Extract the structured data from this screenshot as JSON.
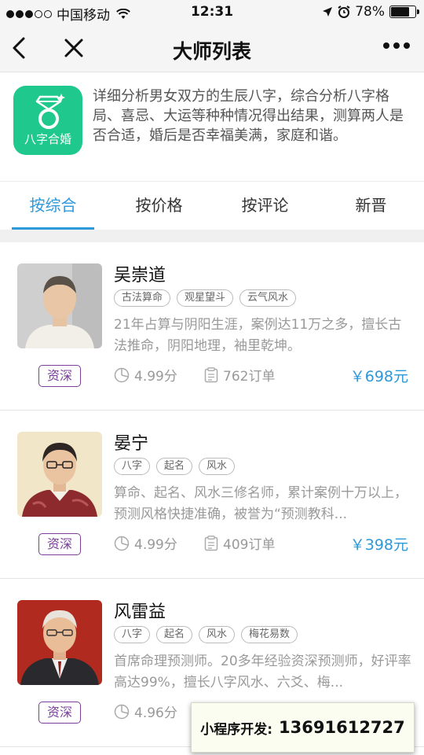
{
  "status_bar": {
    "carrier": "中国移动",
    "time": "12:31",
    "battery": "78%",
    "battery_level": 0.78,
    "signal_icon": "signal-dots-icon",
    "wifi_icon": "wifi-icon",
    "location_icon": "location-arrow-icon",
    "alarm_icon": "alarm-clock-icon"
  },
  "nav": {
    "title": "大师列表",
    "back_icon": "chevron-left-icon",
    "close_icon": "close-icon",
    "more_icon": "more-dots-icon"
  },
  "intro": {
    "icon_label": "八字合婚",
    "icon_color": "#1fc98d",
    "description": "详细分析男女双方的生辰八字，综合分析八字格局、喜忌、大运等种种情况得出结果，测算两人是否合适，婚后是否幸福美满，家庭和谐。"
  },
  "tabs": [
    {
      "label": "按综合",
      "active": true
    },
    {
      "label": "按价格",
      "active": false
    },
    {
      "label": "按评论",
      "active": false
    },
    {
      "label": "新晋",
      "active": false
    }
  ],
  "masters": [
    {
      "name": "吴崇道",
      "tags": [
        "古法算命",
        "观星望斗",
        "云气风水"
      ],
      "description": "21年占算与阴阳生涯，案例达11万之多，擅长古法推命，阴阳地理，袖里乾坤。",
      "badge": "资深",
      "rating": "4.99分",
      "orders": "762订单",
      "price": "￥698元"
    },
    {
      "name": "晏宁",
      "tags": [
        "八字",
        "起名",
        "风水"
      ],
      "description": "算命、起名、风水三修名师，累计案例十万以上，预测风格快捷准确，被誉为“预测教科...",
      "badge": "资深",
      "rating": "4.99分",
      "orders": "409订单",
      "price": "￥398元"
    },
    {
      "name": "风雷益",
      "tags": [
        "八字",
        "起名",
        "风水",
        "梅花易数"
      ],
      "description": "首席命理预测师。20多年经验资深预测师，好评率高达99%，擅长八字风水、六爻、梅...",
      "badge": "资深",
      "rating": "4.96分",
      "orders": "",
      "price": ""
    }
  ],
  "overlay": {
    "label": "小程序开发:",
    "phone": "13691612727"
  },
  "colors": {
    "accent": "#2d98da",
    "badge": "#7b3f9b",
    "price": "#2d98da"
  }
}
